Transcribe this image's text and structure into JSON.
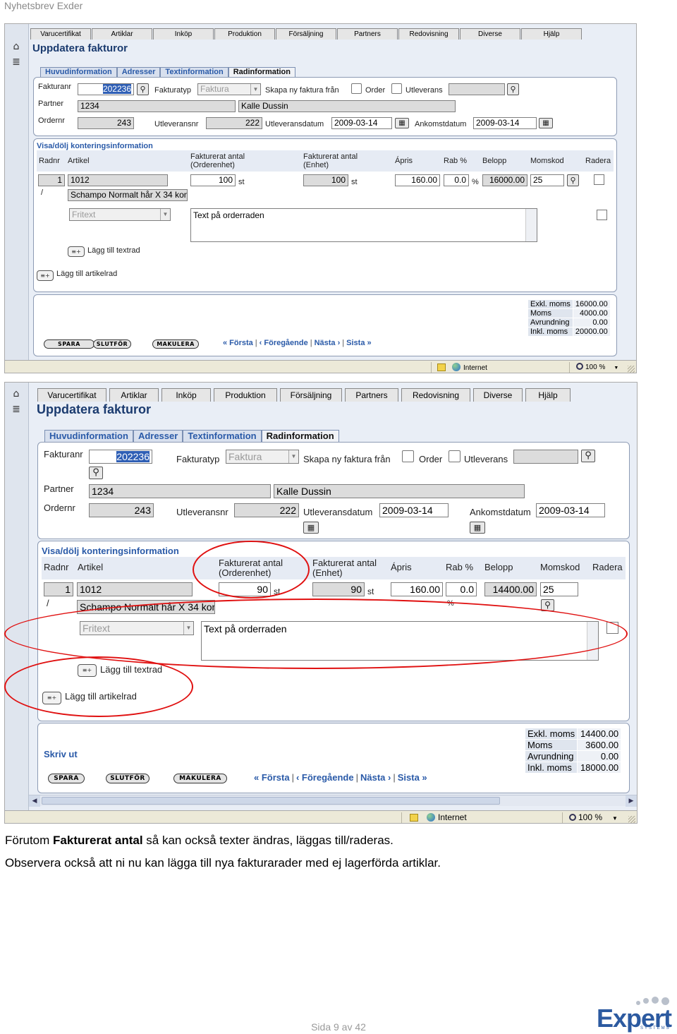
{
  "doc": {
    "header": "Nyhetsbrev Exder",
    "caption_line1_a": "Förutom ",
    "caption_line1_b": "Fakturerat antal",
    "caption_line1_c": " så kan också texter ändras, läggas till/raderas.",
    "caption_line2": "Observera också att ni nu kan lägga till nya fakturarader med ej lagerförda artiklar.",
    "page_label": "Sida 9 av 42",
    "logo_word": "Expert",
    "logo_sub": "SYSTEMS"
  },
  "menu": [
    "Varucertifikat",
    "Artiklar",
    "Inköp",
    "Produktion",
    "Försäljning",
    "Partners",
    "Redovisning",
    "Diverse",
    "Hjälp"
  ],
  "page_title": "Uppdatera fakturor",
  "tabs": [
    "Huvudinformation",
    "Adresser",
    "Textinformation",
    "Radinformation"
  ],
  "labels": {
    "fakturanr": "Fakturanr",
    "fakturatyp": "Fakturatyp",
    "skapa": "Skapa ny faktura från",
    "order": "Order",
    "utleverans": "Utleverans",
    "partner": "Partner",
    "ordernr": "Ordernr",
    "utleveransnr": "Utleveransnr",
    "utleveransdatum": "Utleveransdatum",
    "ankomstdatum": "Ankomstdatum",
    "section": "Visa/dölj konteringsinformation",
    "radnr": "Radnr",
    "artikel": "Artikel",
    "fakt_order_1": "Fakturerat antal",
    "fakt_order_2": "(Orderenhet)",
    "fakt_enhet_1": "Fakturerat antal",
    "fakt_enhet_2": "(Enhet)",
    "apris": "Ápris",
    "rab": "Rab %",
    "belopp": "Belopp",
    "momskod": "Momskod",
    "radera": "Radera",
    "unit": "st",
    "percent": "%",
    "slash": "/",
    "add_text": "Lägg till textrad",
    "add_article": "Lägg till artikelrad",
    "skriv_ut": "Skriv ut",
    "exkl": "Exkl. moms",
    "moms": "Moms",
    "avrundning": "Avrundning",
    "inkl": "Inkl. moms"
  },
  "values": {
    "fakturanr": "202236",
    "fakturatyp": "Faktura",
    "partner_nr": "1234",
    "partner_name": "Kalle Dussin",
    "ordernr": "243",
    "utleveransnr": "222",
    "utleveransdatum": "2009-03-14",
    "ankomstdatum": "2009-03-14",
    "radnr": "1",
    "artikel_nr": "1012",
    "artikel_name": "Schampo Normalt hår X 34 kon",
    "fritext": "Fritext",
    "orderrad_text": "Text på orderraden",
    "apris": "160.00",
    "rab": "0.0",
    "momskod": "25"
  },
  "shot1": {
    "antal_order": "100",
    "antal_enhet": "100",
    "belopp": "16000.00",
    "exkl": "16000.00",
    "moms": "4000.00",
    "avrundning": "0.00",
    "inkl": "20000.00"
  },
  "shot2": {
    "antal_order": "90",
    "antal_enhet": "90",
    "belopp": "14400.00",
    "exkl": "14400.00",
    "moms": "3600.00",
    "avrundning": "0.00",
    "inkl": "18000.00"
  },
  "buttons": {
    "spara": "SPARA",
    "slutfor": "SLUTFÖR",
    "makulera": "MAKULERA"
  },
  "pager": {
    "first": "« Första",
    "prev": "‹ Föregående",
    "next": "Nästa ›",
    "last": "Sista »",
    "sep": "|"
  },
  "status": {
    "zone": "Internet",
    "zoom": "100 %",
    "zoom_arrow": "▼"
  },
  "icons": {
    "search": "search-icon",
    "calendar": "calendar-icon",
    "home": "home-icon",
    "menu": "menu-icon",
    "add": "add-row-icon",
    "annotation_color": "#e01010"
  }
}
